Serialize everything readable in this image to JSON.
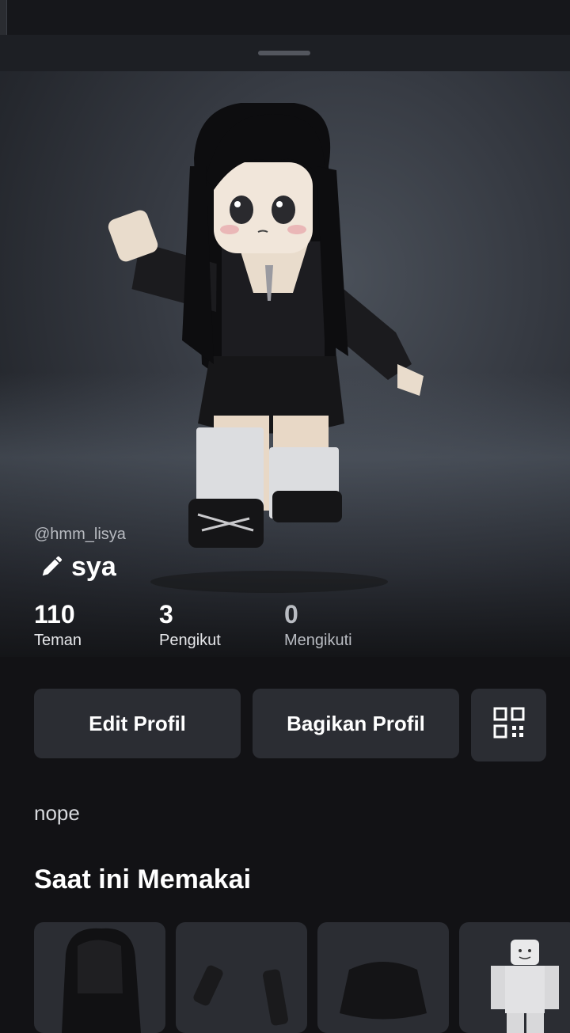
{
  "profile": {
    "display_name": "sya",
    "username": "@hmm_lisya",
    "bio": "nope"
  },
  "stats": [
    {
      "value": "110",
      "label": "Teman"
    },
    {
      "value": "3",
      "label": "Pengikut"
    },
    {
      "value": "0",
      "label": "Mengikuti"
    }
  ],
  "actions": {
    "edit_label": "Edit Profil",
    "share_label": "Bagikan Profil",
    "qr_icon": "qr-code-icon"
  },
  "wearing": {
    "title": "Saat ini Memakai",
    "items": [
      {
        "icon": "black-hair-item"
      },
      {
        "icon": "black-gloves-item"
      },
      {
        "icon": "black-skirt-item"
      },
      {
        "icon": "white-body-item"
      }
    ]
  },
  "colors": {
    "background": "#121215",
    "button": "#2b2d33",
    "text": "#ffffff",
    "muted": "#b9bcc2"
  }
}
